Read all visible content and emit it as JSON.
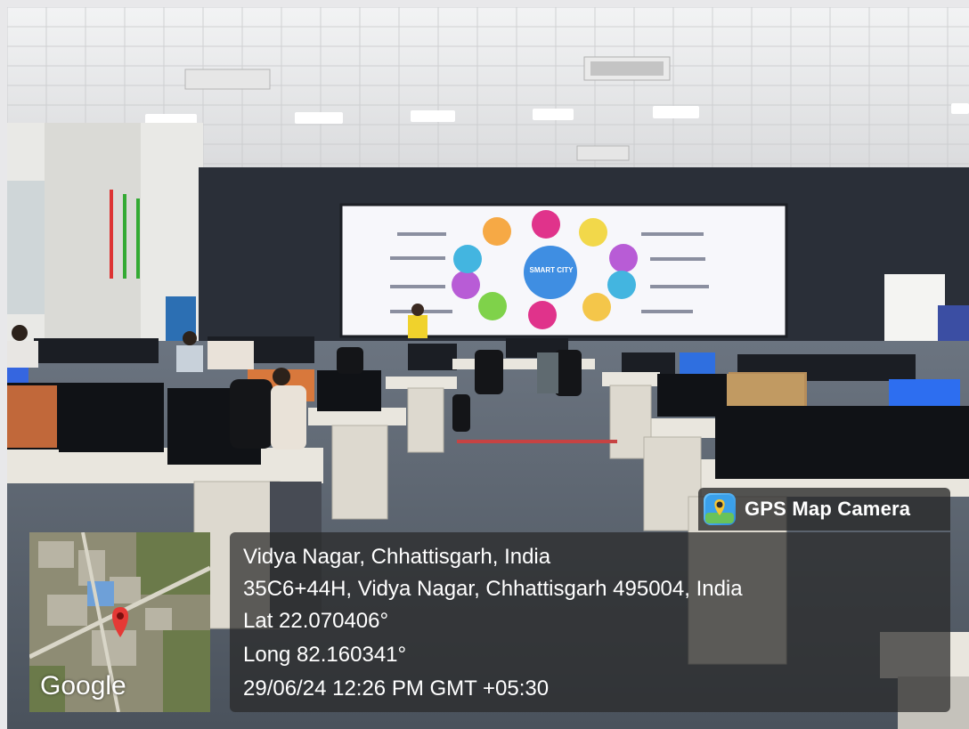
{
  "screen": {
    "heading": "",
    "center_label": "SMART CITY"
  },
  "gps": {
    "app_name": "GPS Map Camera",
    "app_icon": "map-pin-icon",
    "location_title": "Vidya Nagar, Chhattisgarh, India",
    "address": "35C6+44H, Vidya Nagar, Chhattisgarh 495004, India",
    "latitude": "Lat 22.070406°",
    "longitude": "Long 82.160341°",
    "datetime": "29/06/24 12:26 PM GMT +05:30"
  },
  "map": {
    "provider_logo": "Google",
    "pin_icon": "red-location-pin-icon"
  },
  "colors": {
    "overlay_bg": "#282828",
    "overlay_text": "#ffffff",
    "pin": "#e53935",
    "app_icon_bg": "#3aa0ea"
  }
}
